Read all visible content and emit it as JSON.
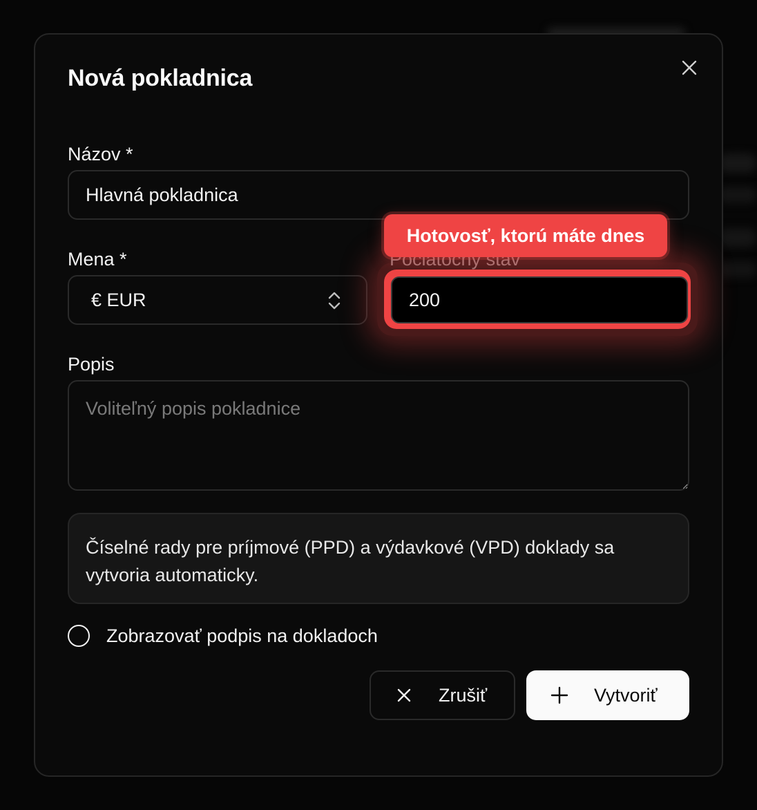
{
  "dialog": {
    "title": "Nová pokladnica",
    "close_icon": "close-icon"
  },
  "form": {
    "name": {
      "label": "Názov *",
      "value": "Hlavná pokladnica"
    },
    "currency": {
      "label": "Mena *",
      "value": "€ EUR",
      "icon": "chevron-up-down-icon"
    },
    "balance": {
      "label": "Počiatočný stav",
      "value": "200",
      "tooltip": "Hotovosť, ktorú máte dnes",
      "highlight_color": "#ef4444"
    },
    "description": {
      "label": "Popis",
      "placeholder": "Voliteľný popis pokladnice",
      "value": ""
    },
    "info_text": "Číselné rady pre príjmové (PPD) a výdavkové (VPD) doklady sa vytvoria automaticky.",
    "signature_option": {
      "label": "Zobrazovať podpis na dokladoch",
      "checked": false
    }
  },
  "actions": {
    "cancel_label": "Zrušiť",
    "cancel_icon": "x-icon",
    "create_label": "Vytvoriť",
    "create_icon": "plus-icon"
  },
  "colors": {
    "background": "#0a0a0a",
    "border": "#262626",
    "accent": "#ef4444",
    "primary_button": "#fafafa"
  }
}
